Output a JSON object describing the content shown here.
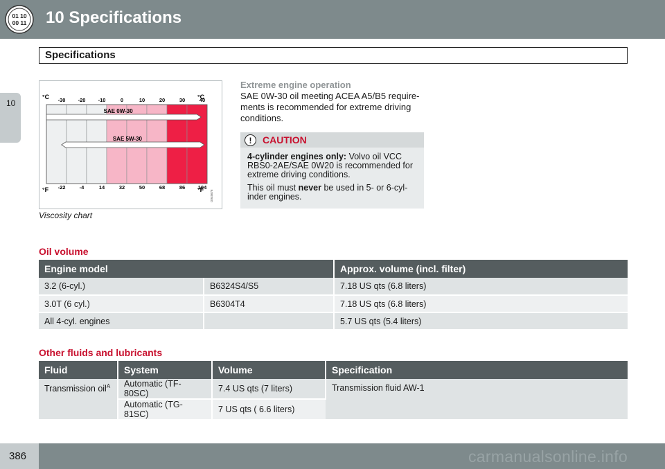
{
  "header": {
    "chapter_title": "10  Specifications",
    "icon_top": "01 10",
    "icon_bottom": "00 11"
  },
  "section_title": "Specifications",
  "side_tab": "10",
  "viscosity_chart": {
    "caption": "Viscosity chart",
    "celsius_unit": "°C",
    "fahrenheit_unit": "°F",
    "celsius_ticks": [
      "-30",
      "-20",
      "-10",
      "0",
      "10",
      "20",
      "30",
      "40"
    ],
    "fahrenheit_ticks": [
      "-22",
      "-4",
      "14",
      "32",
      "50",
      "68",
      "86",
      "104"
    ],
    "bars": [
      {
        "label": "SAE 0W-30"
      },
      {
        "label": "SAE 5W-30"
      }
    ],
    "code": "G045676",
    "colors": {
      "cold": "#eef0f1",
      "mild": "#f7b6c7",
      "hot": "#ee1f45"
    }
  },
  "extreme": {
    "title": "Extreme engine operation",
    "text": "SAE 0W-30 oil meeting ACEA A5/B5 require-ments is recommended for extreme driving conditions."
  },
  "caution": {
    "label": "CAUTION",
    "icon": "!",
    "p1_bold": "4-cylinder engines only:",
    "p1_rest": " Volvo oil VCC RBS0-2AE/SAE 0W20 is recommended for extreme driving conditions.",
    "p2_pre": "This oil must ",
    "p2_bold": "never",
    "p2_post": " be used in 5- or 6-cyl-inder engines."
  },
  "oil_volume": {
    "heading": "Oil volume",
    "headers": [
      "Engine model",
      "Approx. volume (incl. filter)"
    ],
    "rows": [
      {
        "model": "3.2 (6-cyl.)",
        "code": "B6324S4/S5",
        "volume": "7.18 US qts (6.8 liters)"
      },
      {
        "model": "3.0T (6 cyl.)",
        "code": "B6304T4",
        "volume": "7.18 US qts (6.8 liters)"
      },
      {
        "model": "All 4-cyl. engines",
        "code": "",
        "volume": "5.7 US qts (5.4 liters)"
      }
    ]
  },
  "other_fluids": {
    "heading": "Other fluids and lubricants",
    "headers": [
      "Fluid",
      "System",
      "Volume",
      "Specification"
    ],
    "fluid": "Transmission oil",
    "fluid_sup": "A",
    "spec": "Transmission fluid AW-1",
    "rows": [
      {
        "system": "Automatic (TF-80SC)",
        "volume": "7.4 US qts (7 liters)"
      },
      {
        "system": "Automatic (TG-81SC)",
        "volume": "7 US qts ( 6.6 liters)"
      }
    ]
  },
  "footer": {
    "page_number": "386",
    "watermark": "carmanualsonline.info"
  }
}
